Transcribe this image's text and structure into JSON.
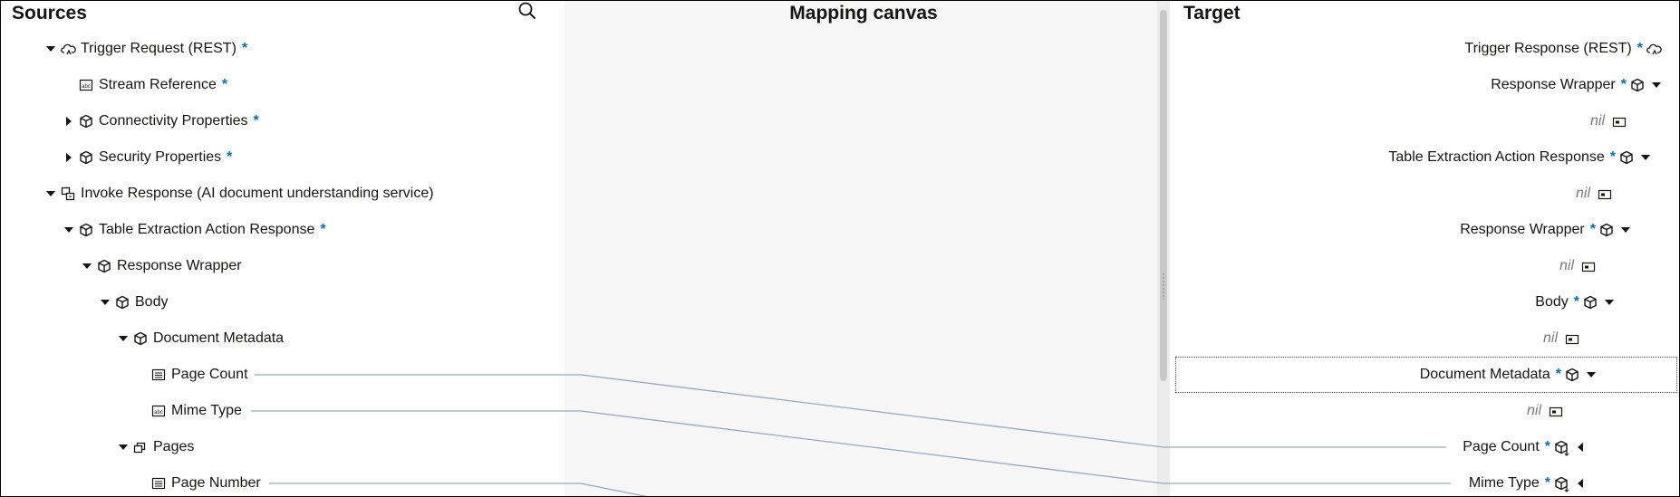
{
  "sources": {
    "title": "Sources",
    "rows": [
      {
        "label": "Trigger Request (REST)",
        "required": true,
        "icon": "cloud-trigger-icon",
        "caret": "down"
      },
      {
        "label": "Stream Reference",
        "required": true,
        "icon": "abc-text-icon",
        "caret": "none"
      },
      {
        "label": "Connectivity Properties",
        "required": true,
        "icon": "cube-icon",
        "caret": "right"
      },
      {
        "label": "Security Properties",
        "required": true,
        "icon": "cube-icon",
        "caret": "right"
      },
      {
        "label": "Invoke Response (AI document understanding service)",
        "required": false,
        "icon": "invoke-icon",
        "caret": "down"
      },
      {
        "label": "Table Extraction Action Response",
        "required": true,
        "icon": "cube-icon",
        "caret": "down"
      },
      {
        "label": "Response Wrapper",
        "required": false,
        "icon": "cube-icon",
        "caret": "down"
      },
      {
        "label": "Body",
        "required": false,
        "icon": "cube-icon",
        "caret": "down"
      },
      {
        "label": "Document Metadata",
        "required": false,
        "icon": "cube-icon",
        "caret": "down"
      },
      {
        "label": "Page Count",
        "required": false,
        "icon": "number-icon",
        "caret": "none"
      },
      {
        "label": "Mime Type",
        "required": false,
        "icon": "abc-text-icon",
        "caret": "none"
      },
      {
        "label": "Pages",
        "required": false,
        "icon": "collection-icon",
        "caret": "down"
      },
      {
        "label": "Page Number",
        "required": false,
        "icon": "number-icon",
        "caret": "none"
      }
    ]
  },
  "canvas": {
    "title": "Mapping canvas"
  },
  "target": {
    "title": "Target",
    "rows": [
      {
        "label": "Trigger Response (REST)",
        "required": true,
        "icon": "cloud-trigger-icon",
        "caret": "none"
      },
      {
        "label": "Response Wrapper",
        "required": true,
        "icon": "cube-icon",
        "caret": "down"
      },
      {
        "label": "nil",
        "nil": true
      },
      {
        "label": "Table Extraction Action Response",
        "required": true,
        "icon": "cube-icon",
        "caret": "down"
      },
      {
        "label": "nil",
        "nil": true
      },
      {
        "label": "Response Wrapper",
        "required": true,
        "icon": "cube-icon",
        "caret": "down"
      },
      {
        "label": "nil",
        "nil": true
      },
      {
        "label": "Body",
        "required": true,
        "icon": "cube-icon",
        "caret": "down"
      },
      {
        "label": "nil",
        "nil": true
      },
      {
        "label": "Document Metadata",
        "required": true,
        "icon": "cube-icon",
        "caret": "down"
      },
      {
        "label": "nil",
        "nil": true
      },
      {
        "label": "Page Count",
        "required": true,
        "icon": "cube-mapped-icon",
        "caret": "left"
      },
      {
        "label": "Mime Type",
        "required": true,
        "icon": "cube-mapped-icon",
        "caret": "left"
      }
    ]
  },
  "required_marker": "*",
  "colors": {
    "accent": "#0a6fb6",
    "mapping_line": "#9aa6c8",
    "canvas_bg": "#f6f6f6"
  }
}
